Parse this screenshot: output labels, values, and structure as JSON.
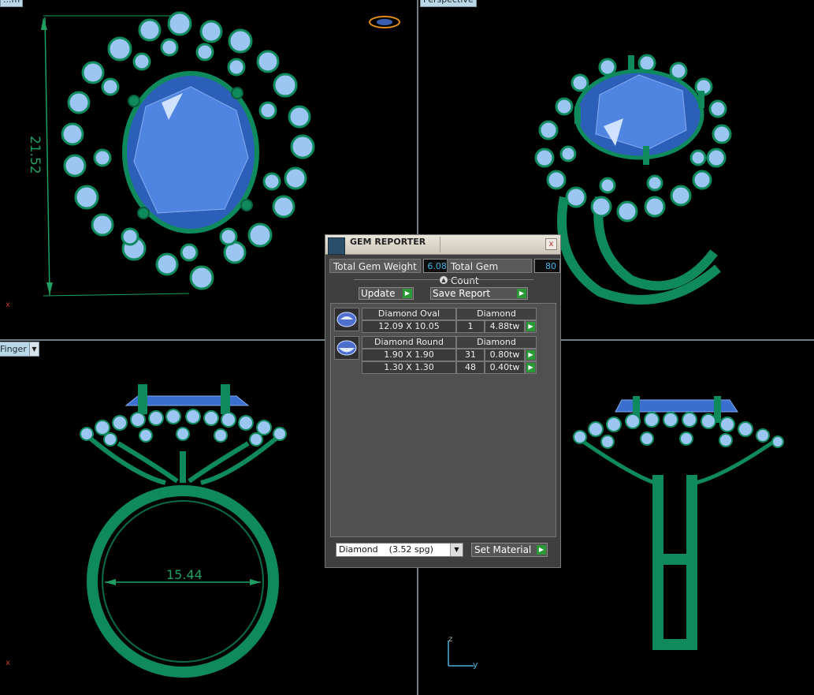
{
  "viewports": {
    "top_left": {
      "label": "...m",
      "dimension": "21.52",
      "axis": "x"
    },
    "top_right": {
      "label": "Perspective"
    },
    "bottom_left": {
      "label": "Finger",
      "dimension": "15.44",
      "axis": "x"
    },
    "bottom_right": {
      "axis_z": "z",
      "axis_y": "y"
    }
  },
  "colors": {
    "metal": "#0f8a5c",
    "gem_center": "#4f84e0",
    "gem_side": "#9cc6f2",
    "dimension_line": "#1fa061"
  },
  "gem_reporter": {
    "title": "GEM REPORTER",
    "close_icon": "x",
    "total_weight_label": "Total Gem Weight",
    "total_weight_value": "6.08",
    "total_count_label": "Total Gem Count",
    "total_count_value": "80",
    "update_label": "Update",
    "save_report_label": "Save Report",
    "groups": [
      {
        "shape": "Diamond Oval",
        "material": "Diamond",
        "icon": "oval-gem-icon",
        "rows": [
          {
            "size": "12.09 X 10.05",
            "count": "1",
            "weight": "4.88tw"
          }
        ]
      },
      {
        "shape": "Diamond Round",
        "material": "Diamond",
        "icon": "round-gem-icon",
        "rows": [
          {
            "size": "1.90 X 1.90",
            "count": "31",
            "weight": "0.80tw"
          },
          {
            "size": "1.30 X 1.30",
            "count": "48",
            "weight": "0.40tw"
          }
        ]
      }
    ],
    "material_select": "Diamond    (3.52 spg)",
    "set_material_label": "Set Material"
  }
}
